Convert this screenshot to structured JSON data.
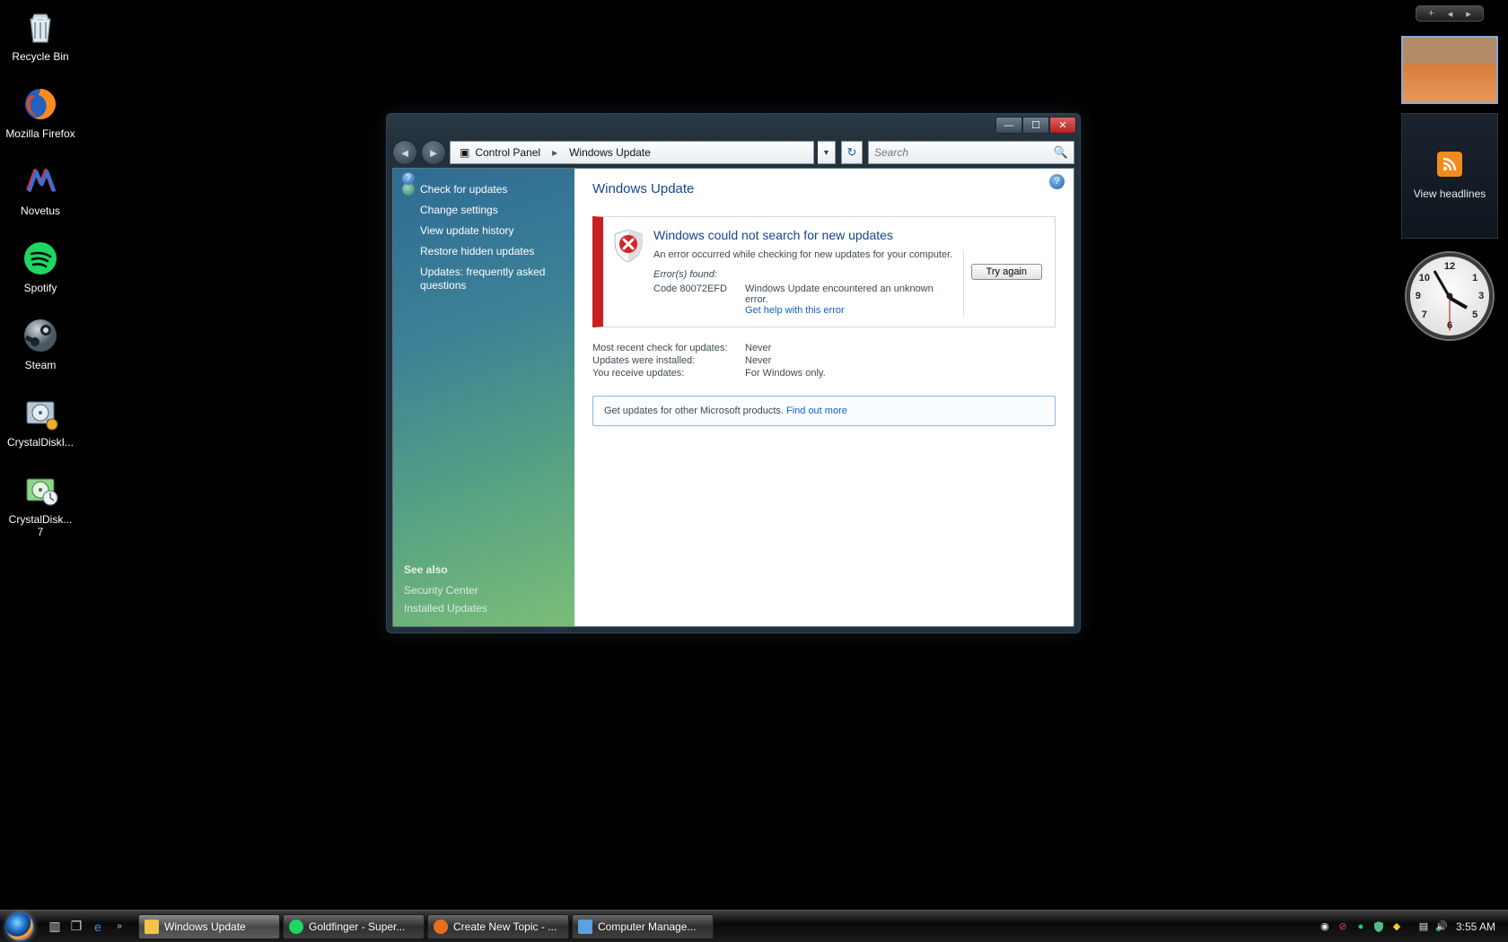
{
  "desktop_icons": [
    {
      "id": "recycle-bin",
      "label": "Recycle Bin"
    },
    {
      "id": "firefox",
      "label": "Mozilla Firefox"
    },
    {
      "id": "novetus",
      "label": "Novetus"
    },
    {
      "id": "spotify",
      "label": "Spotify"
    },
    {
      "id": "steam",
      "label": "Steam"
    },
    {
      "id": "crystaldiski",
      "label": "CrystalDiskI..."
    },
    {
      "id": "crystaldisk7",
      "label": "CrystalDisk... 7"
    }
  ],
  "gadgets": {
    "rss_label": "View headlines"
  },
  "window": {
    "breadcrumb": [
      "Control Panel",
      "Windows Update"
    ],
    "search_placeholder": "Search",
    "sidebar": {
      "items": [
        "Check for updates",
        "Change settings",
        "View update history",
        "Restore hidden updates",
        "Updates: frequently asked questions"
      ],
      "see_also": "See also",
      "links": [
        "Security Center",
        "Installed Updates"
      ]
    },
    "main": {
      "title": "Windows Update",
      "error_title": "Windows could not search for new updates",
      "error_msg": "An error occurred while checking for new updates for your computer.",
      "try_again": "Try again",
      "errors_found": "Error(s) found:",
      "error_code": "Code 80072EFD",
      "error_detail": "Windows Update encountered an unknown error.",
      "error_help": "Get help with this error",
      "info": [
        {
          "k": "Most recent check for updates:",
          "v": "Never"
        },
        {
          "k": "Updates were installed:",
          "v": "Never"
        },
        {
          "k": "You receive updates:",
          "v": "For Windows only."
        }
      ],
      "promo_text": "Get updates for other Microsoft products. ",
      "promo_link": "Find out more"
    }
  },
  "taskbar": {
    "tasks": [
      {
        "id": "windows-update",
        "label": "Windows Update",
        "color": "#f2c544"
      },
      {
        "id": "spotify",
        "label": "Goldfinger - Super...",
        "color": "#1ed760"
      },
      {
        "id": "firefox",
        "label": "Create New Topic - ...",
        "color": "#e66f1f"
      },
      {
        "id": "compmgmt",
        "label": "Computer Manage...",
        "color": "#5aa1de"
      }
    ],
    "clock": "3:55 AM"
  }
}
